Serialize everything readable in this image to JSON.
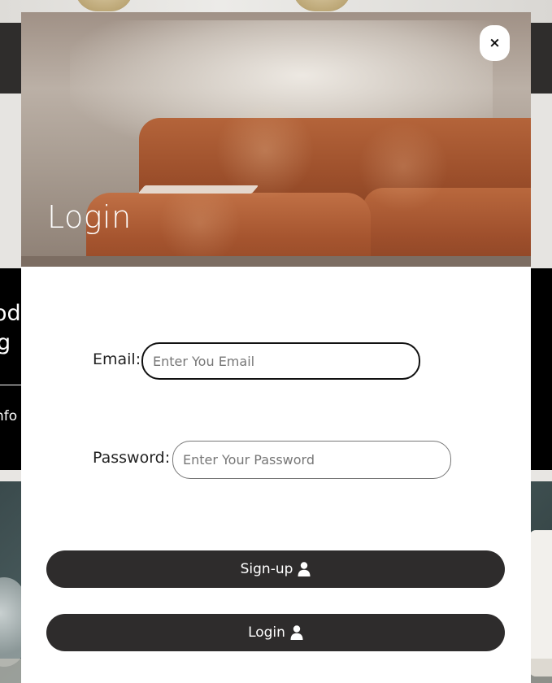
{
  "modal": {
    "title": "Login",
    "close_label": "×",
    "email": {
      "label": "Email:",
      "placeholder": "Enter You Email",
      "value": ""
    },
    "password": {
      "label": "Password:",
      "placeholder": "Enter Your Password",
      "value": ""
    },
    "buttons": {
      "signup": {
        "label": "Sign-up",
        "icon": "user-icon"
      },
      "login": {
        "label": "Login",
        "icon": "user-icon"
      }
    }
  },
  "background": {
    "text_line_1": "od",
    "text_line_2": "g",
    "text_line_3": "nfo"
  },
  "colors": {
    "button_bg": "#2e2c2c",
    "header_bg": "#2f2d2c",
    "accent_sofa": "#a6552f"
  }
}
